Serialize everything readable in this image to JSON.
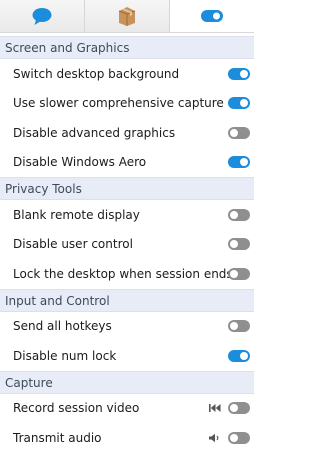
{
  "colors": {
    "accent": "#1c8cdc",
    "toggle_off": "#8f8f8f",
    "section_bg": "#e7ecf6"
  },
  "tabs": [
    {
      "icon": "chat-bubble-icon",
      "active": false
    },
    {
      "icon": "package-icon",
      "active": false
    },
    {
      "icon": "toggle-icon",
      "active": true
    }
  ],
  "sections": [
    {
      "title": "Screen and Graphics",
      "items": [
        {
          "label": "Switch desktop background",
          "on": true
        },
        {
          "label": "Use slower comprehensive capture",
          "on": true
        },
        {
          "label": "Disable advanced graphics",
          "on": false
        },
        {
          "label": "Disable Windows Aero",
          "on": true
        }
      ]
    },
    {
      "title": "Privacy Tools",
      "items": [
        {
          "label": "Blank remote display",
          "on": false
        },
        {
          "label": "Disable user control",
          "on": false
        },
        {
          "label": "Lock the desktop when session ends",
          "on": false
        }
      ]
    },
    {
      "title": "Input and Control",
      "items": [
        {
          "label": "Send all hotkeys",
          "on": false
        },
        {
          "label": "Disable num lock",
          "on": true
        }
      ]
    },
    {
      "title": "Capture",
      "items": [
        {
          "label": "Record session video",
          "on": false,
          "extra_icon": "skip-back-icon"
        },
        {
          "label": "Transmit audio",
          "on": false,
          "extra_icon": "speaker-icon"
        }
      ]
    }
  ]
}
